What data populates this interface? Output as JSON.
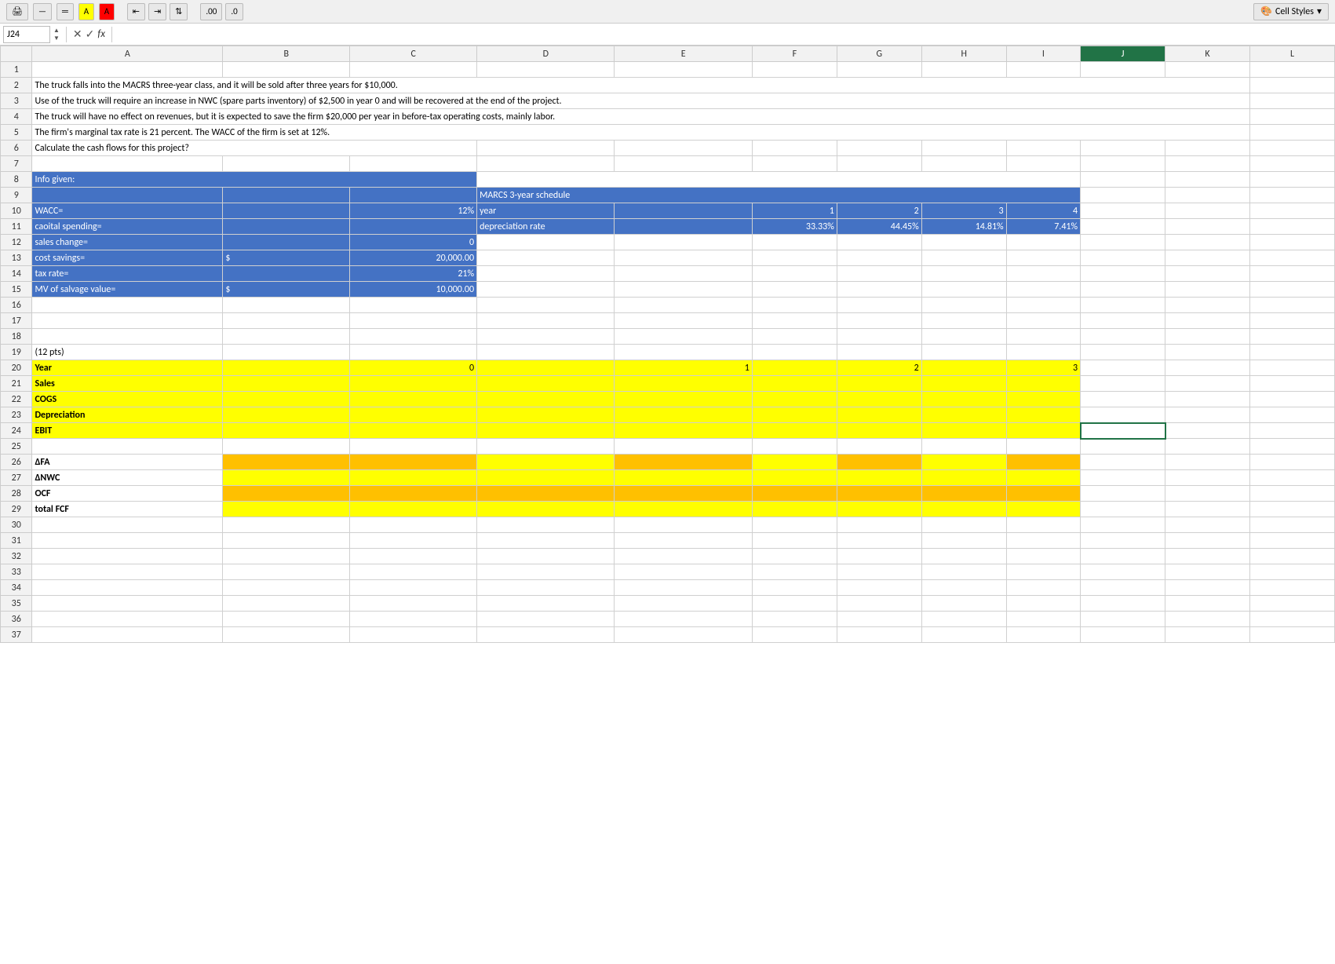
{
  "toolbar": {
    "cell_styles_label": "Cell Styles",
    "cell_ref": "J24",
    "formula_fx": "fx"
  },
  "columns": [
    "",
    "A",
    "B",
    "C",
    "D",
    "E",
    "F",
    "G",
    "H",
    "I",
    "J",
    "K",
    "L"
  ],
  "rows": [
    {
      "num": 1,
      "cells": [
        "",
        "",
        "",
        "",
        "",
        "",
        "",
        "",
        "",
        "",
        "",
        "",
        ""
      ]
    },
    {
      "num": 2,
      "cells": [
        "",
        "The truck falls into the MACRS three-year class, and it will be sold after three years for $10,000.",
        "",
        "",
        "",
        "",
        "",
        "",
        "",
        "",
        "",
        "",
        ""
      ]
    },
    {
      "num": 3,
      "cells": [
        "",
        "Use of the truck will require an increase in NWC (spare parts inventory) of $2,500 in year 0 and will be recovered at the end of the project.",
        "",
        "",
        "",
        "",
        "",
        "",
        "",
        "",
        "",
        "",
        ""
      ]
    },
    {
      "num": 4,
      "cells": [
        "",
        "The truck will have no effect on revenues, but it is expected to save the firm $20,000 per year in before-tax operating costs, mainly labor.",
        "",
        "",
        "",
        "",
        "",
        "",
        "",
        "",
        "",
        "",
        ""
      ]
    },
    {
      "num": 5,
      "cells": [
        "",
        "The firm's marginal tax rate is 21 percent.  The WACC of the firm is set at 12%.",
        "",
        "",
        "",
        "",
        "",
        "",
        "",
        "",
        "",
        "",
        ""
      ]
    },
    {
      "num": 6,
      "cells": [
        "",
        "Calculate the cash flows for this project?",
        "",
        "",
        "",
        "",
        "",
        "",
        "",
        "",
        "",
        "",
        ""
      ]
    },
    {
      "num": 7,
      "cells": [
        "",
        "",
        "",
        "",
        "",
        "",
        "",
        "",
        "",
        "",
        "",
        "",
        ""
      ]
    },
    {
      "num": 8,
      "cells": [
        "",
        "Info given:",
        "",
        "",
        "",
        "",
        "",
        "",
        "",
        "",
        "",
        "",
        ""
      ],
      "row_bg": "blue_partial"
    },
    {
      "num": 9,
      "cells": [
        "",
        "",
        "",
        "",
        "MARCS 3-year schedule",
        "",
        "",
        "",
        "",
        "",
        "",
        "",
        ""
      ],
      "row_bg": "blue_partial_9"
    },
    {
      "num": 10,
      "cells": [
        "",
        "WACC=",
        "",
        "12%",
        "year",
        "",
        "1",
        "2",
        "3",
        "4",
        "",
        "",
        ""
      ],
      "row_bg": "blue_partial_10"
    },
    {
      "num": 11,
      "cells": [
        "",
        "caoital spending=",
        "",
        "",
        "depreciation rate",
        "",
        "33.33%",
        "44.45%",
        "14.81%",
        "7.41%",
        "",
        "",
        ""
      ],
      "row_bg": "blue_partial_11"
    },
    {
      "num": 12,
      "cells": [
        "",
        "sales change=",
        "",
        "0",
        "",
        "",
        "",
        "",
        "",
        "",
        "",
        "",
        ""
      ],
      "row_bg": "blue_partial_12"
    },
    {
      "num": 13,
      "cells": [
        "",
        "cost savings=",
        "$",
        "20,000.00",
        "",
        "",
        "",
        "",
        "",
        "",
        "",
        "",
        ""
      ],
      "row_bg": "blue_partial_13"
    },
    {
      "num": 14,
      "cells": [
        "",
        "tax rate=",
        "",
        "21%",
        "",
        "",
        "",
        "",
        "",
        "",
        "",
        "",
        ""
      ],
      "row_bg": "blue_partial_14"
    },
    {
      "num": 15,
      "cells": [
        "",
        "MV of salvage value=",
        "$",
        "10,000.00",
        "",
        "",
        "",
        "",
        "",
        "",
        "",
        "",
        ""
      ],
      "row_bg": "blue_partial_15"
    },
    {
      "num": 16,
      "cells": [
        "",
        "",
        "",
        "",
        "",
        "",
        "",
        "",
        "",
        "",
        "",
        "",
        ""
      ]
    },
    {
      "num": 17,
      "cells": [
        "",
        "",
        "",
        "",
        "",
        "",
        "",
        "",
        "",
        "",
        "",
        "",
        ""
      ]
    },
    {
      "num": 18,
      "cells": [
        "",
        "",
        "",
        "",
        "",
        "",
        "",
        "",
        "",
        "",
        "",
        "",
        ""
      ]
    },
    {
      "num": 19,
      "cells": [
        "",
        "(12 pts)",
        "",
        "",
        "",
        "",
        "",
        "",
        "",
        "",
        "",
        "",
        ""
      ]
    },
    {
      "num": 20,
      "cells": [
        "",
        "Year",
        "",
        "0",
        "",
        "1",
        "",
        "2",
        "",
        "3",
        "",
        "",
        ""
      ],
      "row_bg": "yellow_partial"
    },
    {
      "num": 21,
      "cells": [
        "",
        "Sales",
        "",
        "",
        "",
        "",
        "",
        "",
        "",
        "",
        "",
        "",
        ""
      ],
      "row_bg": "yellow_partial"
    },
    {
      "num": 22,
      "cells": [
        "",
        "COGS",
        "",
        "",
        "",
        "",
        "",
        "",
        "",
        "",
        "",
        "",
        ""
      ],
      "row_bg": "yellow_partial"
    },
    {
      "num": 23,
      "cells": [
        "",
        "Depreciation",
        "",
        "",
        "",
        "",
        "",
        "",
        "",
        "",
        "",
        "",
        ""
      ],
      "row_bg": "yellow_partial"
    },
    {
      "num": 24,
      "cells": [
        "",
        "EBIT",
        "",
        "",
        "",
        "",
        "",
        "",
        "",
        "",
        "",
        "",
        ""
      ],
      "row_bg": "yellow_partial",
      "selected_j": true
    },
    {
      "num": 25,
      "cells": [
        "",
        "",
        "",
        "",
        "",
        "",
        "",
        "",
        "",
        "",
        "",
        "",
        ""
      ]
    },
    {
      "num": 26,
      "cells": [
        "",
        "ΔFA",
        "",
        "",
        "",
        "",
        "",
        "",
        "",
        "",
        "",
        "",
        ""
      ],
      "row_bg": "orange_partial"
    },
    {
      "num": 27,
      "cells": [
        "",
        "ΔNWC",
        "",
        "",
        "",
        "",
        "",
        "",
        "",
        "",
        "",
        "",
        ""
      ],
      "row_bg": "yellow_partial2"
    },
    {
      "num": 28,
      "cells": [
        "",
        "OCF",
        "",
        "",
        "",
        "",
        "",
        "",
        "",
        "",
        "",
        "",
        ""
      ],
      "row_bg": "orange_partial2"
    },
    {
      "num": 29,
      "cells": [
        "",
        "total FCF",
        "",
        "",
        "",
        "",
        "",
        "",
        "",
        "",
        "",
        "",
        ""
      ],
      "row_bg": "yellow_partial3"
    },
    {
      "num": 30,
      "cells": [
        "",
        "",
        "",
        "",
        "",
        "",
        "",
        "",
        "",
        "",
        "",
        "",
        ""
      ]
    },
    {
      "num": 31,
      "cells": [
        "",
        "",
        "",
        "",
        "",
        "",
        "",
        "",
        "",
        "",
        "",
        "",
        ""
      ]
    },
    {
      "num": 32,
      "cells": [
        "",
        "",
        "",
        "",
        "",
        "",
        "",
        "",
        "",
        "",
        "",
        "",
        ""
      ]
    },
    {
      "num": 33,
      "cells": [
        "",
        "",
        "",
        "",
        "",
        "",
        "",
        "",
        "",
        "",
        "",
        "",
        ""
      ]
    },
    {
      "num": 34,
      "cells": [
        "",
        "",
        "",
        "",
        "",
        "",
        "",
        "",
        "",
        "",
        "",
        "",
        ""
      ]
    },
    {
      "num": 35,
      "cells": [
        "",
        "",
        "",
        "",
        "",
        "",
        "",
        "",
        "",
        "",
        "",
        "",
        ""
      ]
    },
    {
      "num": 36,
      "cells": [
        "",
        "",
        "",
        "",
        "",
        "",
        "",
        "",
        "",
        "",
        "",
        "",
        ""
      ]
    },
    {
      "num": 37,
      "cells": [
        "",
        "",
        "",
        "",
        "",
        "",
        "",
        "",
        "",
        "",
        "",
        "",
        ""
      ]
    }
  ]
}
